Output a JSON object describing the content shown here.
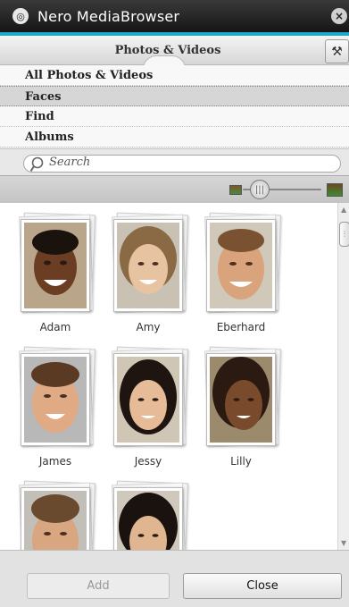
{
  "window": {
    "title": "Nero MediaBrowser",
    "close_glyph": "×"
  },
  "tabs": {
    "active_label": "Photos & Videos",
    "tools_icon": "hammer-icon"
  },
  "nav": {
    "items": [
      {
        "label": "All Photos & Videos",
        "selected": false
      },
      {
        "label": "Faces",
        "selected": true
      },
      {
        "label": "Find",
        "selected": false
      },
      {
        "label": "Albums",
        "selected": false
      }
    ]
  },
  "search": {
    "placeholder": "Search"
  },
  "people": [
    {
      "name": "Adam"
    },
    {
      "name": "Amy"
    },
    {
      "name": "Eberhard"
    },
    {
      "name": "James"
    },
    {
      "name": "Jessy"
    },
    {
      "name": "Lilly"
    },
    {
      "name": ""
    },
    {
      "name": ""
    }
  ],
  "footer": {
    "add_label": "Add",
    "close_label": "Close"
  },
  "colors": {
    "accent": "#20a8c8",
    "titlebar": "#1c1c1c"
  }
}
